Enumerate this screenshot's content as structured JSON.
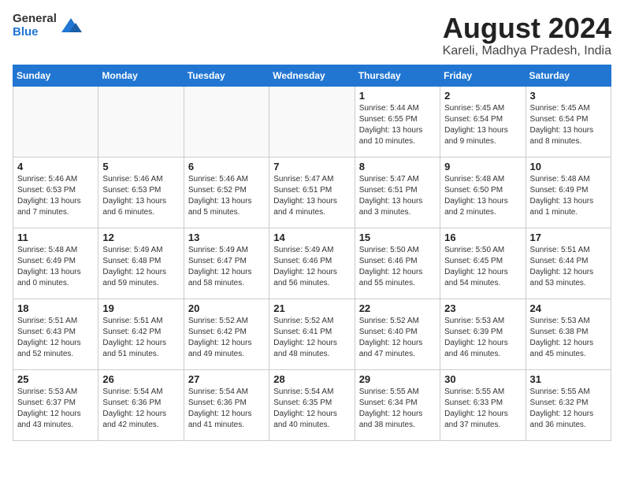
{
  "logo": {
    "general": "General",
    "blue": "Blue"
  },
  "title": "August 2024",
  "location": "Kareli, Madhya Pradesh, India",
  "headers": [
    "Sunday",
    "Monday",
    "Tuesday",
    "Wednesday",
    "Thursday",
    "Friday",
    "Saturday"
  ],
  "weeks": [
    [
      {
        "day": "",
        "info": ""
      },
      {
        "day": "",
        "info": ""
      },
      {
        "day": "",
        "info": ""
      },
      {
        "day": "",
        "info": ""
      },
      {
        "day": "1",
        "info": "Sunrise: 5:44 AM\nSunset: 6:55 PM\nDaylight: 13 hours\nand 10 minutes."
      },
      {
        "day": "2",
        "info": "Sunrise: 5:45 AM\nSunset: 6:54 PM\nDaylight: 13 hours\nand 9 minutes."
      },
      {
        "day": "3",
        "info": "Sunrise: 5:45 AM\nSunset: 6:54 PM\nDaylight: 13 hours\nand 8 minutes."
      }
    ],
    [
      {
        "day": "4",
        "info": "Sunrise: 5:46 AM\nSunset: 6:53 PM\nDaylight: 13 hours\nand 7 minutes."
      },
      {
        "day": "5",
        "info": "Sunrise: 5:46 AM\nSunset: 6:53 PM\nDaylight: 13 hours\nand 6 minutes."
      },
      {
        "day": "6",
        "info": "Sunrise: 5:46 AM\nSunset: 6:52 PM\nDaylight: 13 hours\nand 5 minutes."
      },
      {
        "day": "7",
        "info": "Sunrise: 5:47 AM\nSunset: 6:51 PM\nDaylight: 13 hours\nand 4 minutes."
      },
      {
        "day": "8",
        "info": "Sunrise: 5:47 AM\nSunset: 6:51 PM\nDaylight: 13 hours\nand 3 minutes."
      },
      {
        "day": "9",
        "info": "Sunrise: 5:48 AM\nSunset: 6:50 PM\nDaylight: 13 hours\nand 2 minutes."
      },
      {
        "day": "10",
        "info": "Sunrise: 5:48 AM\nSunset: 6:49 PM\nDaylight: 13 hours\nand 1 minute."
      }
    ],
    [
      {
        "day": "11",
        "info": "Sunrise: 5:48 AM\nSunset: 6:49 PM\nDaylight: 13 hours\nand 0 minutes."
      },
      {
        "day": "12",
        "info": "Sunrise: 5:49 AM\nSunset: 6:48 PM\nDaylight: 12 hours\nand 59 minutes."
      },
      {
        "day": "13",
        "info": "Sunrise: 5:49 AM\nSunset: 6:47 PM\nDaylight: 12 hours\nand 58 minutes."
      },
      {
        "day": "14",
        "info": "Sunrise: 5:49 AM\nSunset: 6:46 PM\nDaylight: 12 hours\nand 56 minutes."
      },
      {
        "day": "15",
        "info": "Sunrise: 5:50 AM\nSunset: 6:46 PM\nDaylight: 12 hours\nand 55 minutes."
      },
      {
        "day": "16",
        "info": "Sunrise: 5:50 AM\nSunset: 6:45 PM\nDaylight: 12 hours\nand 54 minutes."
      },
      {
        "day": "17",
        "info": "Sunrise: 5:51 AM\nSunset: 6:44 PM\nDaylight: 12 hours\nand 53 minutes."
      }
    ],
    [
      {
        "day": "18",
        "info": "Sunrise: 5:51 AM\nSunset: 6:43 PM\nDaylight: 12 hours\nand 52 minutes."
      },
      {
        "day": "19",
        "info": "Sunrise: 5:51 AM\nSunset: 6:42 PM\nDaylight: 12 hours\nand 51 minutes."
      },
      {
        "day": "20",
        "info": "Sunrise: 5:52 AM\nSunset: 6:42 PM\nDaylight: 12 hours\nand 49 minutes."
      },
      {
        "day": "21",
        "info": "Sunrise: 5:52 AM\nSunset: 6:41 PM\nDaylight: 12 hours\nand 48 minutes."
      },
      {
        "day": "22",
        "info": "Sunrise: 5:52 AM\nSunset: 6:40 PM\nDaylight: 12 hours\nand 47 minutes."
      },
      {
        "day": "23",
        "info": "Sunrise: 5:53 AM\nSunset: 6:39 PM\nDaylight: 12 hours\nand 46 minutes."
      },
      {
        "day": "24",
        "info": "Sunrise: 5:53 AM\nSunset: 6:38 PM\nDaylight: 12 hours\nand 45 minutes."
      }
    ],
    [
      {
        "day": "25",
        "info": "Sunrise: 5:53 AM\nSunset: 6:37 PM\nDaylight: 12 hours\nand 43 minutes."
      },
      {
        "day": "26",
        "info": "Sunrise: 5:54 AM\nSunset: 6:36 PM\nDaylight: 12 hours\nand 42 minutes."
      },
      {
        "day": "27",
        "info": "Sunrise: 5:54 AM\nSunset: 6:36 PM\nDaylight: 12 hours\nand 41 minutes."
      },
      {
        "day": "28",
        "info": "Sunrise: 5:54 AM\nSunset: 6:35 PM\nDaylight: 12 hours\nand 40 minutes."
      },
      {
        "day": "29",
        "info": "Sunrise: 5:55 AM\nSunset: 6:34 PM\nDaylight: 12 hours\nand 38 minutes."
      },
      {
        "day": "30",
        "info": "Sunrise: 5:55 AM\nSunset: 6:33 PM\nDaylight: 12 hours\nand 37 minutes."
      },
      {
        "day": "31",
        "info": "Sunrise: 5:55 AM\nSunset: 6:32 PM\nDaylight: 12 hours\nand 36 minutes."
      }
    ]
  ]
}
